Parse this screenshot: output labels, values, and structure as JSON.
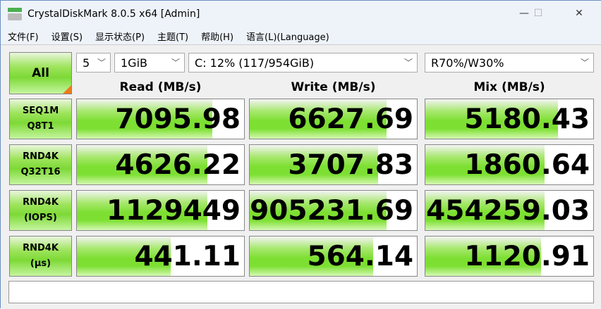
{
  "window": {
    "title": "CrystalDiskMark 8.0.5 x64 [Admin]",
    "minimize": "—",
    "maximize": "☐",
    "close": "✕"
  },
  "menu": [
    "文件(F)",
    "设置(S)",
    "显示状态(P)",
    "主题(T)",
    "帮助(H)",
    "语言(L)(Language)"
  ],
  "controls": {
    "all_label": "All",
    "count": "5",
    "size": "1GiB",
    "drive": "C: 12% (117/954GiB)",
    "mix": "R70%/W30%",
    "chevron": "﹀"
  },
  "headers": {
    "read": "Read (MB/s)",
    "write": "Write (MB/s)",
    "mix": "Mix (MB/s)"
  },
  "rows": [
    {
      "l1": "SEQ1M",
      "l2": "Q8T1",
      "read": "7095.98",
      "write": "6627.69",
      "mix": "5180.43",
      "read_fill": 0.81,
      "write_fill": 0.82,
      "mix_fill": 0.79
    },
    {
      "l1": "RND4K",
      "l2": "Q32T16",
      "read": "4626.22",
      "write": "3707.83",
      "mix": "1860.64",
      "read_fill": 0.78,
      "write_fill": 0.77,
      "mix_fill": 0.71
    },
    {
      "l1": "RND4K",
      "l2": "(IOPS)",
      "read": "1129449",
      "write": "905231.69",
      "mix": "454259.03",
      "read_fill": 0.78,
      "write_fill": 0.82,
      "mix_fill": 0.71
    },
    {
      "l1": "RND4K",
      "l2": "(μs)",
      "read": "441.11",
      "write": "564.14",
      "mix": "1120.91",
      "read_fill": 0.56,
      "write_fill": 0.74,
      "mix_fill": 0.69
    }
  ],
  "status": ""
}
